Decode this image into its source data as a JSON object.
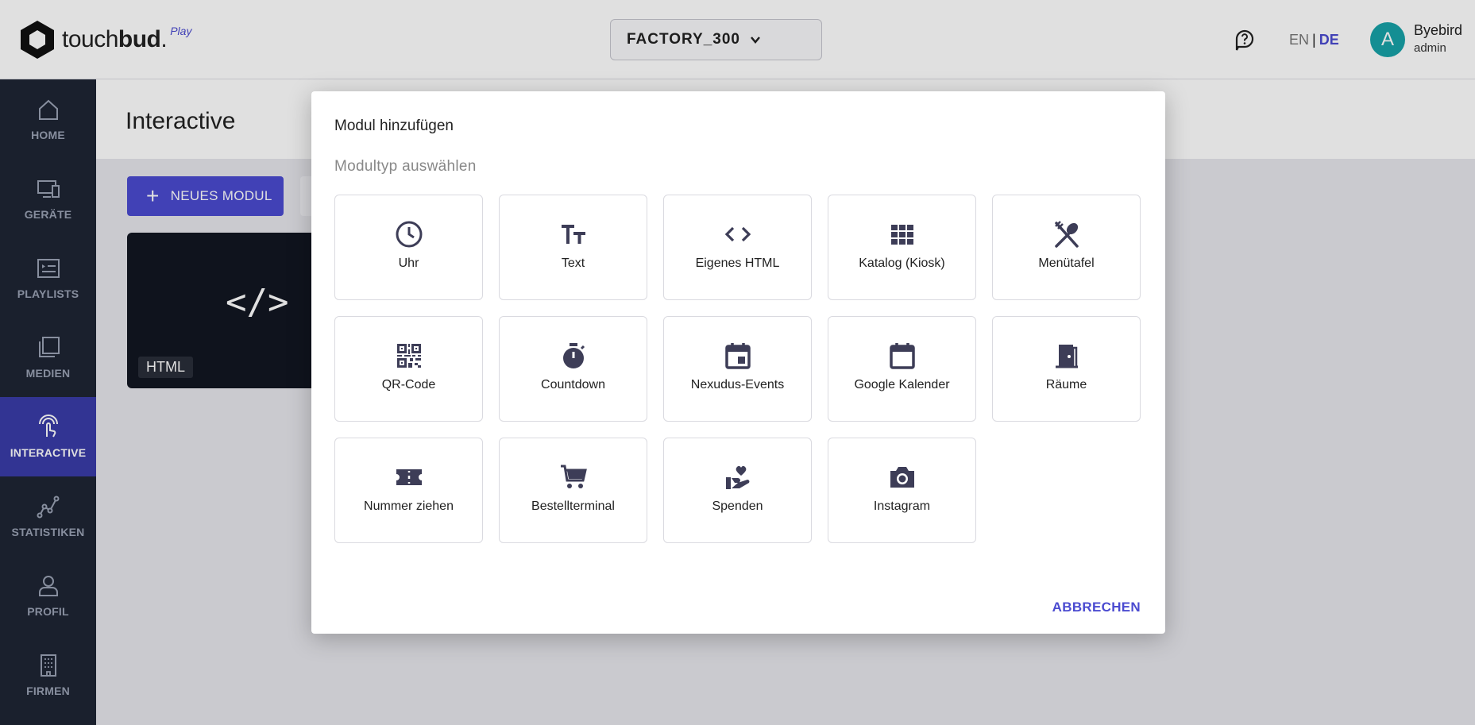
{
  "header": {
    "logo_text": "touch",
    "logo_text_bold": "bud",
    "logo_play": "Play",
    "factory": "FACTORY_300",
    "lang_en": "EN",
    "lang_sep": "|",
    "lang_de": "DE",
    "avatar_initial": "A",
    "user_name": "Byebird",
    "user_role": "admin"
  },
  "sidebar": {
    "items": [
      {
        "label": "HOME",
        "icon": "home-icon"
      },
      {
        "label": "GERÄTE",
        "icon": "devices-icon"
      },
      {
        "label": "PLAYLISTS",
        "icon": "playlist-icon"
      },
      {
        "label": "MEDIEN",
        "icon": "media-icon"
      },
      {
        "label": "INTERACTIVE",
        "icon": "touch-icon"
      },
      {
        "label": "STATISTIKEN",
        "icon": "statistics-icon"
      },
      {
        "label": "PROFIL",
        "icon": "profile-icon"
      },
      {
        "label": "FIRMEN",
        "icon": "building-icon"
      }
    ],
    "active_index": 4
  },
  "main": {
    "title": "Interactive",
    "new_module_label": "NEUES MODUL",
    "card": {
      "code_glyph": "</>",
      "tag": "HTML"
    }
  },
  "dialog": {
    "title": "Modul hinzufügen",
    "subtitle": "Modultyp auswählen",
    "tiles": [
      {
        "label": "Uhr",
        "icon": "clock-icon"
      },
      {
        "label": "Text",
        "icon": "text-icon"
      },
      {
        "label": "Eigenes HTML",
        "icon": "code-icon"
      },
      {
        "label": "Katalog (Kiosk)",
        "icon": "grid-icon"
      },
      {
        "label": "Menütafel",
        "icon": "utensils-icon"
      },
      {
        "label": "QR-Code",
        "icon": "qrcode-icon"
      },
      {
        "label": "Countdown",
        "icon": "timer-icon"
      },
      {
        "label": "Nexudus-Events",
        "icon": "event-icon"
      },
      {
        "label": "Google Kalender",
        "icon": "calendar-icon"
      },
      {
        "label": "Räume",
        "icon": "door-icon"
      },
      {
        "label": "Nummer ziehen",
        "icon": "ticket-icon"
      },
      {
        "label": "Bestellterminal",
        "icon": "cart-icon"
      },
      {
        "label": "Spenden",
        "icon": "donate-icon"
      },
      {
        "label": "Instagram",
        "icon": "camera-icon"
      }
    ],
    "cancel_label": "ABBRECHEN"
  },
  "colors": {
    "accent": "#4b4bd0",
    "sidebar_bg": "#1e2534",
    "sidebar_active": "#3a3ca8",
    "icon": "#3d3d57",
    "avatar": "#17a2a8"
  }
}
